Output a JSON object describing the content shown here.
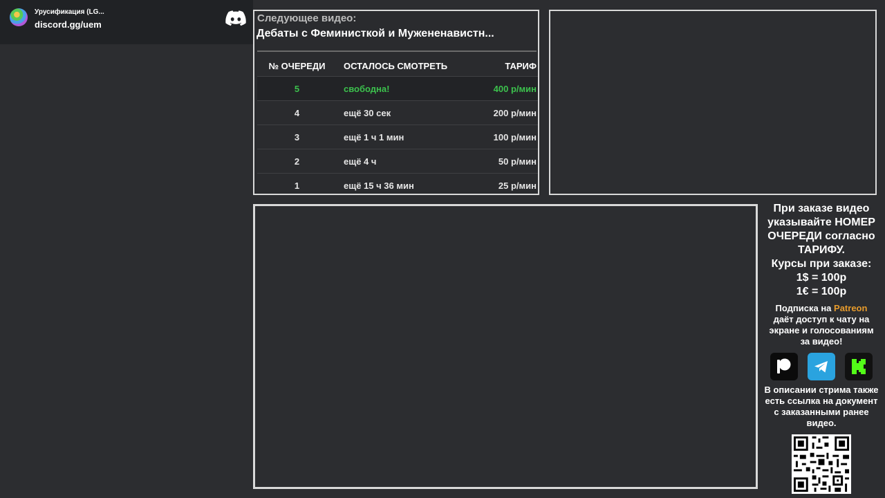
{
  "discord": {
    "server_name": "Урусификация (LG...",
    "invite": "discord.gg/uem",
    "logo_icon": "discord-logo-icon"
  },
  "queue": {
    "next_label": "Следующее видео:",
    "next_title": "Дебаты с Феминисткой и Мужененавистн...",
    "headers": [
      "№ ОЧЕРЕДИ",
      "ОСТАЛОСЬ СМОТРЕТЬ",
      "ТАРИФ"
    ],
    "rows": [
      {
        "num": "5",
        "remaining": "свободна!",
        "tariff": "400 р/мин"
      },
      {
        "num": "4",
        "remaining": "ещё 30 сек",
        "tariff": "200 р/мин"
      },
      {
        "num": "3",
        "remaining": "ещё 1 ч 1 мин",
        "tariff": "100 р/мин"
      },
      {
        "num": "2",
        "remaining": "ещё 4 ч",
        "tariff": "50 р/мин"
      },
      {
        "num": "1",
        "remaining": "ещё 15 ч 36 мин",
        "tariff": "25 р/мин"
      }
    ],
    "free_color": "#3cc14d"
  },
  "info": {
    "order_line1": "При заказе видео",
    "order_line2": "указывайте НОМЕР",
    "order_line3": "ОЧЕРЕДИ согласно",
    "order_line4": "ТАРИФУ.",
    "rates_title": "Курсы при заказе:",
    "rate_usd": "1$ = 100р",
    "rate_eur": "1€ = 100р",
    "sub_prefix": "Подписка на ",
    "sub_patreon": "Patreon",
    "sub_line2": "даёт доступ к чату на",
    "sub_line3": "экране и голосованиям",
    "sub_line4": "за видео!",
    "desc_line1": "В описании стрима также",
    "desc_line2": "есть ссылка на документ",
    "desc_line3": "с заказанными ранее",
    "desc_line4": "видео.",
    "icons": [
      "patreon-icon",
      "telegram-icon",
      "kick-icon"
    ],
    "patreon_color": "#e79b2c"
  }
}
